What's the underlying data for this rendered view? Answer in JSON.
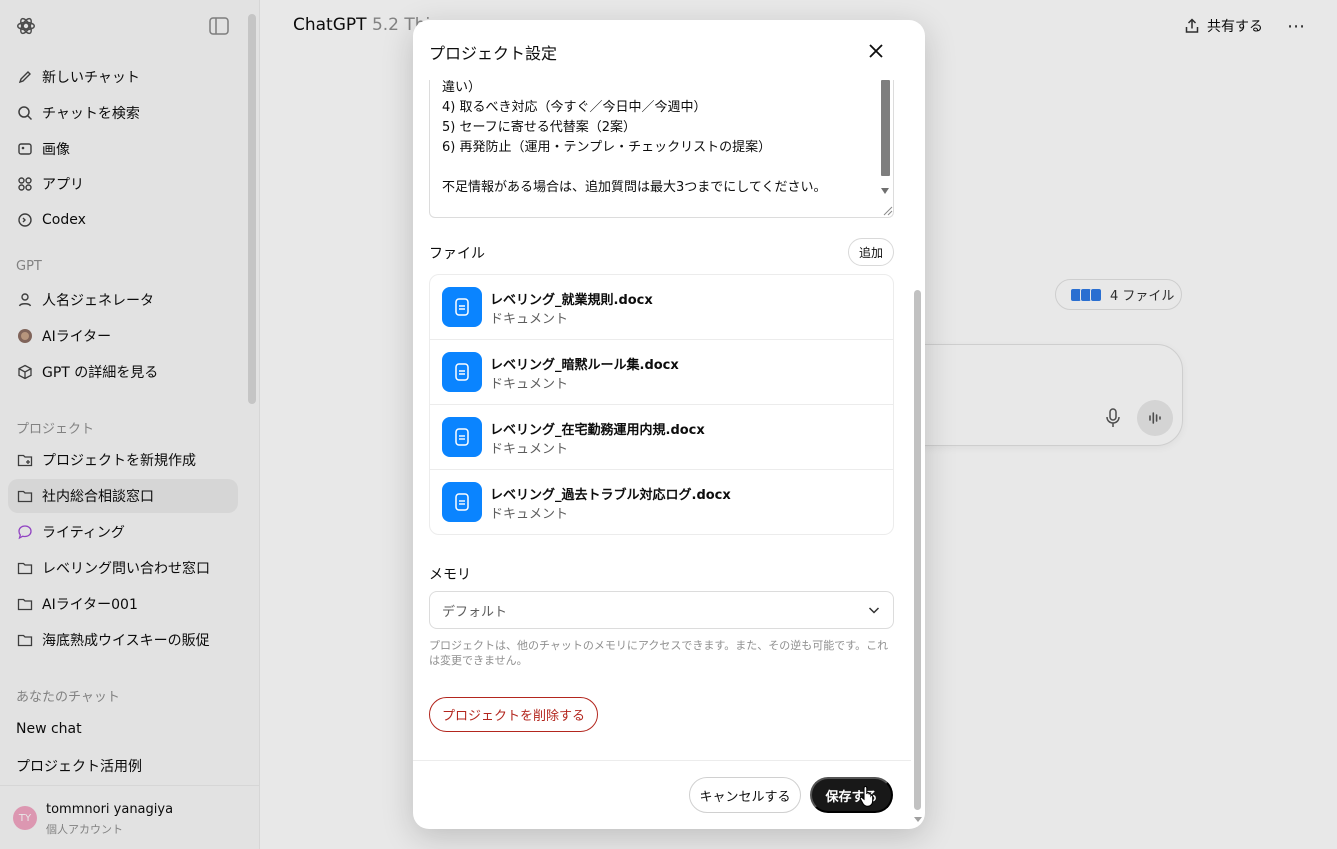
{
  "sidebar": {
    "items_top": [
      {
        "label": "新しいチャット",
        "icon": "edit-icon"
      },
      {
        "label": "チャットを検索",
        "icon": "search-icon"
      },
      {
        "label": "画像",
        "icon": "image-icon"
      },
      {
        "label": "アプリ",
        "icon": "apps-icon"
      },
      {
        "label": "Codex",
        "icon": "codex-icon"
      }
    ],
    "gpt_section": "GPT",
    "gpt_items": [
      {
        "label": "人名ジェネレータ",
        "icon": "person-icon"
      },
      {
        "label": "AIライター",
        "icon": "gpt-avatar-icon"
      },
      {
        "label": "GPT の詳細を見る",
        "icon": "cube-icon"
      }
    ],
    "project_section": "プロジェクト",
    "project_items": [
      {
        "label": "プロジェクトを新規作成",
        "icon": "folder-plus-icon"
      },
      {
        "label": "社内総合相談窓口",
        "icon": "folder-icon"
      },
      {
        "label": "ライティング",
        "icon": "chat-bubble-icon"
      },
      {
        "label": "レベリング問い合わせ窓口",
        "icon": "folder-icon"
      },
      {
        "label": "AIライター001",
        "icon": "folder-icon"
      },
      {
        "label": "海底熟成ウイスキーの販促",
        "icon": "folder-icon"
      }
    ],
    "chats_section": "あなたのチャット",
    "chats": [
      "New chat",
      "プロジェクト活用例"
    ],
    "user": {
      "initials": "TY",
      "name": "tommnori yanagiya",
      "plan": "個人アカウント"
    }
  },
  "header": {
    "title_main": "ChatGPT",
    "title_model": " 5.2 Thi",
    "share_label": "共有する"
  },
  "main": {
    "files_chip_label": "4 ファイル"
  },
  "modal": {
    "title": "プロジェクト設定",
    "instructions_text": "違い）\n4) 取るべき対応（今すぐ／今日中／今週中）\n5) セーフに寄せる代替案（2案）\n6) 再発防止（運用・テンプレ・チェックリストの提案）\n\n不足情報がある場合は、追加質問は最大3つまでにしてください。",
    "files_label": "ファイル",
    "add_label": "追加",
    "files": [
      {
        "name": "レベリング_就業規則.docx",
        "type": "ドキュメント"
      },
      {
        "name": "レベリング_暗黙ルール集.docx",
        "type": "ドキュメント"
      },
      {
        "name": "レベリング_在宅勤務運用内規.docx",
        "type": "ドキュメント"
      },
      {
        "name": "レベリング_過去トラブル対応ログ.docx",
        "type": "ドキュメント"
      }
    ],
    "memory_label": "メモリ",
    "memory_value": "デフォルト",
    "memory_note": "プロジェクトは、他のチャットのメモリにアクセスできます。また、その逆も可能です。これは変更できません。",
    "delete_label": "プロジェクトを削除する",
    "cancel_label": "キャンセルする",
    "save_label": "保存する"
  },
  "colors": {
    "accent_file": "#0a84ff",
    "danger": "#b3261e",
    "primary_button": "#181818"
  }
}
